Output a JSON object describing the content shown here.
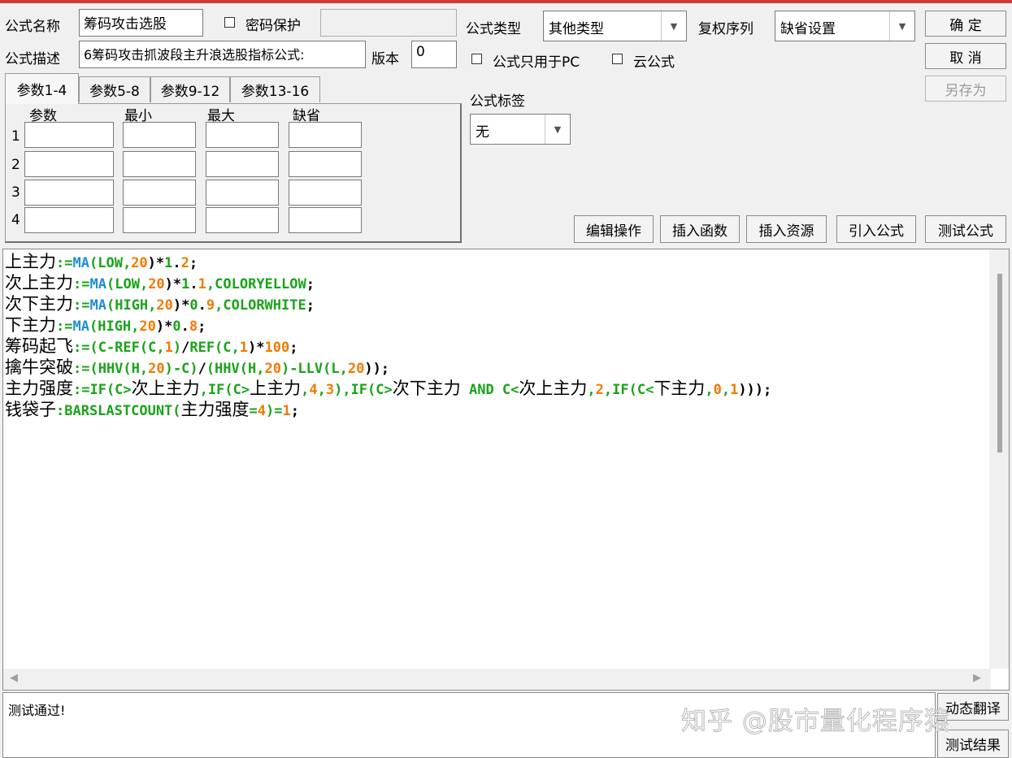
{
  "colors": {
    "keyword_blue": "#1e8fd6",
    "keyword_green": "#19a319",
    "number_orange": "#f07a00",
    "text": "#000000",
    "topbar": "#d23a3a"
  },
  "form": {
    "name_label": "公式名称",
    "name_value": "筹码攻击选股",
    "password_label": "密码保护",
    "desc_label": "公式描述",
    "desc_value": "6筹码攻击抓波段主升浪选股指标公式:",
    "version_label": "版本",
    "version_value": "0",
    "type_label": "公式类型",
    "type_value": "其他类型",
    "rights_label": "复权序列",
    "rights_value": "缺省设置",
    "pc_only_label": "公式只用于PC",
    "cloud_label": "云公式",
    "tag_label": "公式标签",
    "tag_value": "无"
  },
  "buttons": {
    "ok": "确  定",
    "cancel": "取  消",
    "save_as": "另存为",
    "edit_ops": "编辑操作",
    "insert_func": "插入函数",
    "insert_res": "插入资源",
    "import_formula": "引入公式",
    "test_formula": "测试公式",
    "translate": "动态翻译",
    "test_result": "测试结果"
  },
  "tabs": [
    "参数1-4",
    "参数5-8",
    "参数9-12",
    "参数13-16"
  ],
  "params": {
    "headers": [
      "参数",
      "最小",
      "最大",
      "缺省"
    ],
    "rows": [
      "1",
      "2",
      "3",
      "4"
    ]
  },
  "code_lines": [
    [
      [
        "上主力",
        "cn"
      ],
      [
        ":=",
        "g"
      ],
      [
        "MA",
        "b"
      ],
      [
        "(",
        "g"
      ],
      [
        "LOW",
        "g"
      ],
      [
        ",",
        "g"
      ],
      [
        "20",
        "o"
      ],
      [
        ")*",
        "k"
      ],
      [
        "1",
        "g"
      ],
      [
        ".",
        "k"
      ],
      [
        "2",
        "o"
      ],
      [
        ";",
        "k"
      ]
    ],
    [
      [
        "次上主力",
        "cn"
      ],
      [
        ":=",
        "g"
      ],
      [
        "MA",
        "b"
      ],
      [
        "(",
        "g"
      ],
      [
        "LOW",
        "g"
      ],
      [
        ",",
        "g"
      ],
      [
        "20",
        "o"
      ],
      [
        ")*",
        "k"
      ],
      [
        "1",
        "g"
      ],
      [
        ".",
        "k"
      ],
      [
        "1",
        "o"
      ],
      [
        ",COLORYELLOW",
        "g"
      ],
      [
        ";",
        "k"
      ]
    ],
    [
      [
        "次下主力",
        "cn"
      ],
      [
        ":=",
        "g"
      ],
      [
        "MA",
        "b"
      ],
      [
        "(",
        "g"
      ],
      [
        "HIGH",
        "g"
      ],
      [
        ",",
        "g"
      ],
      [
        "20",
        "o"
      ],
      [
        ")*",
        "k"
      ],
      [
        "0",
        "g"
      ],
      [
        ".",
        "k"
      ],
      [
        "9",
        "o"
      ],
      [
        ",COLORWHITE",
        "g"
      ],
      [
        ";",
        "k"
      ]
    ],
    [
      [
        "下主力",
        "cn"
      ],
      [
        ":=",
        "g"
      ],
      [
        "MA",
        "b"
      ],
      [
        "(",
        "g"
      ],
      [
        "HIGH",
        "g"
      ],
      [
        ",",
        "g"
      ],
      [
        "20",
        "o"
      ],
      [
        ")*",
        "k"
      ],
      [
        "0",
        "g"
      ],
      [
        ".",
        "k"
      ],
      [
        "8",
        "o"
      ],
      [
        ";",
        "k"
      ]
    ],
    [
      [
        "筹码起飞",
        "cn"
      ],
      [
        ":=(C-REF(C,",
        "g"
      ],
      [
        "1",
        "o"
      ],
      [
        ")",
        "g"
      ],
      [
        "/",
        "k"
      ],
      [
        "REF(C,",
        "g"
      ],
      [
        "1",
        "o"
      ],
      [
        ")*",
        "k"
      ],
      [
        "100",
        "o"
      ],
      [
        ";",
        "k"
      ]
    ],
    [
      [
        "擒牛突破",
        "cn"
      ],
      [
        ":=(HHV(H,",
        "g"
      ],
      [
        "20",
        "o"
      ],
      [
        ")-C)",
        "g"
      ],
      [
        "/",
        "k"
      ],
      [
        "(HHV(H,",
        "g"
      ],
      [
        "20",
        "o"
      ],
      [
        ")-LLV(L,",
        "g"
      ],
      [
        "20",
        "o"
      ],
      [
        "));",
        "k"
      ]
    ],
    [
      [
        "主力强度",
        "cn"
      ],
      [
        ":=IF(C>",
        "g"
      ],
      [
        "次上主力",
        "cn"
      ],
      [
        ",IF(C>",
        "g"
      ],
      [
        "上主力",
        "cn"
      ],
      [
        ",",
        "g"
      ],
      [
        "4",
        "o"
      ],
      [
        ",",
        "g"
      ],
      [
        "3",
        "o"
      ],
      [
        "),IF(C>",
        "g"
      ],
      [
        "次下主力",
        "cn"
      ],
      [
        " AND C<",
        "g"
      ],
      [
        "次上主力",
        "cn"
      ],
      [
        ",",
        "g"
      ],
      [
        "2",
        "o"
      ],
      [
        ",IF(C<",
        "g"
      ],
      [
        "下主力",
        "cn"
      ],
      [
        ",",
        "g"
      ],
      [
        "0",
        "o"
      ],
      [
        ",",
        "g"
      ],
      [
        "1",
        "o"
      ],
      [
        ")));",
        "k"
      ]
    ],
    [
      [
        "钱袋子",
        "cn"
      ],
      [
        ":BARSLASTCOUNT(",
        "g"
      ],
      [
        "主力强度",
        "cn"
      ],
      [
        "=",
        "g"
      ],
      [
        "4",
        "o"
      ],
      [
        ")=",
        "g"
      ],
      [
        "1",
        "o"
      ],
      [
        ";",
        "k"
      ]
    ]
  ],
  "output_text": "测试通过!",
  "watermark": "知乎 @股市量化程序猿"
}
